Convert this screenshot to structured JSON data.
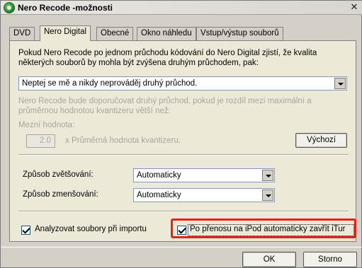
{
  "window": {
    "title": "Nero Recode -možnosti",
    "close_glyph": "✕"
  },
  "tabs": [
    {
      "label": "DVD",
      "active": false
    },
    {
      "label": "Nero Digital",
      "active": true
    },
    {
      "label": "Obecné",
      "active": false
    },
    {
      "label": "Okno náhledu",
      "active": false
    },
    {
      "label": "Vstup/výstup souborů",
      "active": false
    }
  ],
  "second_pass": {
    "intro_line1": "Pokud Nero Recode po jednom průchodu kódování do Nero Digital zjistí, že kvalita",
    "intro_line2": "některých souborů by mohla být zvýšena druhým průchodem, pak:",
    "mode_value": "Neptej se mě a nikdy neprováděj druhý průchod.",
    "note_line1": "Nero Recode bude doporučovat druhý průchod, pokud je rozdíl mezi maximální a",
    "note_line2": "průměrnou hodnotou kvantizeru větší než:",
    "limit_label": "Mezní hodnota:",
    "limit_value": "2.0",
    "limit_suffix": "x Průměrná hodnota kvantizeru.",
    "default_button": "Výchozí"
  },
  "scaling": {
    "upscale_label": "Způsob zvětšování:",
    "upscale_value": "Automaticky",
    "downscale_label": "Způsob zmenšování:",
    "downscale_value": "Automaticky"
  },
  "options": {
    "analyze_label": "Analyzovat soubory při importu",
    "analyze_checked": true,
    "ipod_label": "Po přenosu na iPod automaticky zavřít iTur",
    "ipod_checked": true
  },
  "footer": {
    "ok_label": "OK",
    "cancel_label": "Storno"
  },
  "colors": {
    "highlight": "#e2231a",
    "panel": "#ece9d8",
    "window": "#d4d0c8"
  }
}
